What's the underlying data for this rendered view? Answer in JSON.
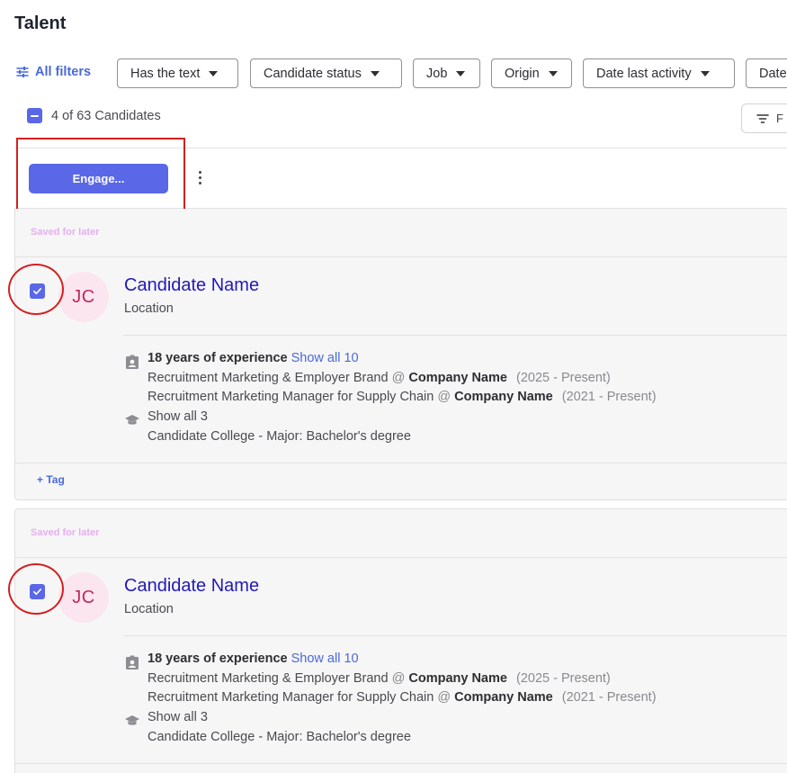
{
  "page": {
    "title": "Talent"
  },
  "filters": {
    "all_filters_label": "All filters",
    "chips": [
      "Has the text",
      "Candidate status",
      "Job",
      "Origin",
      "Date last activity",
      "Date"
    ]
  },
  "selection": {
    "count_text": "4 of 63 Candidates",
    "filter_button_label": "F"
  },
  "actions": {
    "engage_label": "Engage..."
  },
  "candidates": [
    {
      "saved_label": "Saved for later",
      "initials": "JC",
      "name": "Candidate Name",
      "location": "Location",
      "experience_text": "18 years of experience",
      "experience_link": "Show all 10",
      "jobs": [
        {
          "title": "Recruitment Marketing & Employer Brand",
          "at": "@",
          "company": "Company Name",
          "dates": "(2025 - Present)"
        },
        {
          "title": "Recruitment Marketing Manager for Supply Chain",
          "at": "@",
          "company": "Company Name",
          "dates": "(2021 - Present)"
        }
      ],
      "education_link": "Show all 3",
      "education": "Candidate College - Major: Bachelor's degree",
      "tag_label": "+ Tag"
    },
    {
      "saved_label": "Saved for later",
      "initials": "JC",
      "name": "Candidate Name",
      "location": "Location",
      "experience_text": "18 years of experience",
      "experience_link": "Show all 10",
      "jobs": [
        {
          "title": "Recruitment Marketing & Employer Brand",
          "at": "@",
          "company": "Company Name",
          "dates": "(2025 - Present)"
        },
        {
          "title": "Recruitment Marketing Manager for Supply Chain",
          "at": "@",
          "company": "Company Name",
          "dates": "(2021 - Present)"
        }
      ],
      "education_link": "Show all 3",
      "education": "Candidate College - Major: Bachelor's degree"
    }
  ],
  "colors": {
    "accent": "#5a67e6",
    "link": "#4a69d9",
    "name_link": "#2318b8",
    "annotation": "#d42020",
    "saved_label": "#e4b0ee",
    "avatar_bg": "#fbe6ef",
    "avatar_text": "#c2275e"
  }
}
